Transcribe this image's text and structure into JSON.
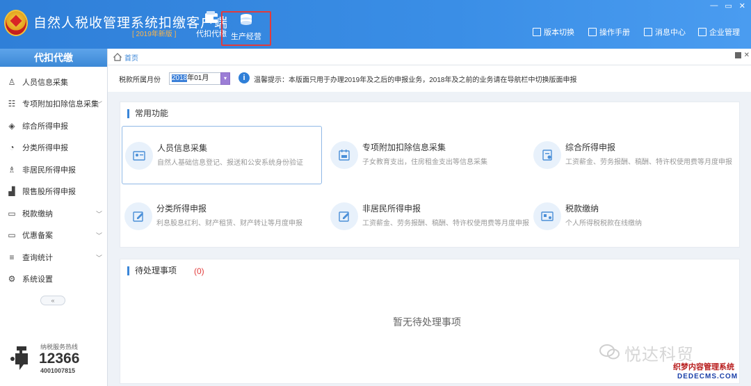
{
  "header": {
    "title": "自然人税收管理系统扣缴客户端",
    "year_badge": "[ 2019年新版 ]",
    "nav": [
      {
        "label": "代扣代缴",
        "icon": "wallet-icon"
      },
      {
        "label": "生产经营",
        "icon": "coins-icon"
      }
    ],
    "links": [
      {
        "label": "版本切换",
        "icon": "switch-icon"
      },
      {
        "label": "操作手册",
        "icon": "manual-icon"
      },
      {
        "label": "消息中心",
        "icon": "mail-icon"
      },
      {
        "label": "企业管理",
        "icon": "building-icon"
      }
    ],
    "window_controls": [
      "—",
      "▭",
      "✕"
    ]
  },
  "sidebar": {
    "heading": "代扣代缴",
    "items": [
      {
        "label": "人员信息采集",
        "icon": "person-icon",
        "has_chevron": false
      },
      {
        "label": "专项附加扣除信息采集",
        "icon": "list-icon",
        "has_chevron": true
      },
      {
        "label": "综合所得申报",
        "icon": "layers-icon",
        "has_chevron": false
      },
      {
        "label": "分类所得申报",
        "icon": "pie-icon",
        "has_chevron": false
      },
      {
        "label": "非居民所得申报",
        "icon": "person-outline-icon",
        "has_chevron": false
      },
      {
        "label": "限售股所得申报",
        "icon": "bar-chart-icon",
        "has_chevron": false
      },
      {
        "label": "税款缴纳",
        "icon": "folder-icon",
        "has_chevron": true
      },
      {
        "label": "优惠备案",
        "icon": "folder-icon",
        "has_chevron": true
      },
      {
        "label": "查询统计",
        "icon": "search-list-icon",
        "has_chevron": true
      },
      {
        "label": "系统设置",
        "icon": "gear-icon",
        "has_chevron": false
      }
    ],
    "collapse_label": "«",
    "hotline": {
      "label": "纳税服务热线",
      "number": "12366",
      "sub": "4001007815"
    }
  },
  "breadcrumb": {
    "label": "首页"
  },
  "filter": {
    "label": "税款所属月份",
    "value_selected": "2018",
    "value_rest": "年01月",
    "dropdown": "▾",
    "tip": "温馨提示：本版面只用于办理2019年及之后的申报业务，2018年及之前的业务请在导航栏中切换版面申报"
  },
  "common": {
    "title": "常用功能",
    "items": [
      {
        "name": "人员信息采集",
        "desc": "自然人基础信息登记、报送和公安系统身份验证"
      },
      {
        "name": "专项附加扣除信息采集",
        "desc": "子女教育支出，住房租金支出等信息采集"
      },
      {
        "name": "综合所得申报",
        "desc": "工资薪金、劳务报酬、稿酬、特许权使用费等月度申报"
      },
      {
        "name": "分类所得申报",
        "desc": "利息股息红利、财产租赁、财产转让等月度申报"
      },
      {
        "name": "非居民所得申报",
        "desc": "工资薪金、劳务报酬、稿酬、特许权使用费等月度申报"
      },
      {
        "name": "税款缴纳",
        "desc": "个人所得税税款在线缴纳"
      }
    ]
  },
  "pending": {
    "title": "待处理事项",
    "count": "(0)",
    "empty": "暂无待处理事项"
  },
  "watermark": {
    "brand": "悦达科贸",
    "corner_cn": "织梦内容管理系统",
    "corner_en": "DEDECMS.COM"
  },
  "colors": {
    "header": "#3a8ee6",
    "accent": "#3a86d8",
    "alert": "#e23b3b"
  }
}
